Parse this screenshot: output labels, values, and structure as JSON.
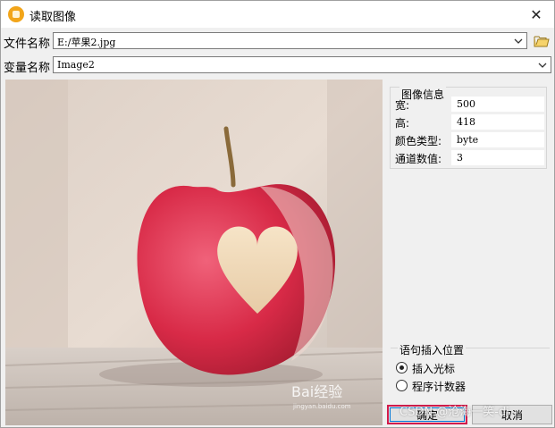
{
  "window": {
    "title": "读取图像",
    "close_glyph": "✕"
  },
  "file_row": {
    "label": "文件名称",
    "value": "E:/苹果2.jpg"
  },
  "var_row": {
    "label": "变量名称",
    "value": "Image2"
  },
  "image_info": {
    "title": "图像信息",
    "rows": [
      {
        "label": "宽:",
        "value": "500"
      },
      {
        "label": "高:",
        "value": "418"
      },
      {
        "label": "颜色类型:",
        "value": "byte"
      },
      {
        "label": "通道数值:",
        "value": "3"
      }
    ]
  },
  "insert_position": {
    "title": "语句插入位置",
    "options": [
      {
        "label": "插入光标",
        "checked": true
      },
      {
        "label": "程序计数器",
        "checked": false
      }
    ]
  },
  "buttons": {
    "ok": "确定",
    "cancel": "取消"
  },
  "preview": {
    "watermark_text": "Bai经验",
    "watermark_sub": "jingyan.baidu.com"
  },
  "overlay": {
    "watermark": "CSDN @沧海一笑-dj"
  },
  "icons": {
    "app": "app-icon",
    "close": "close-icon",
    "dropdown": "chevron-down-icon",
    "folder": "folder-open-icon"
  }
}
